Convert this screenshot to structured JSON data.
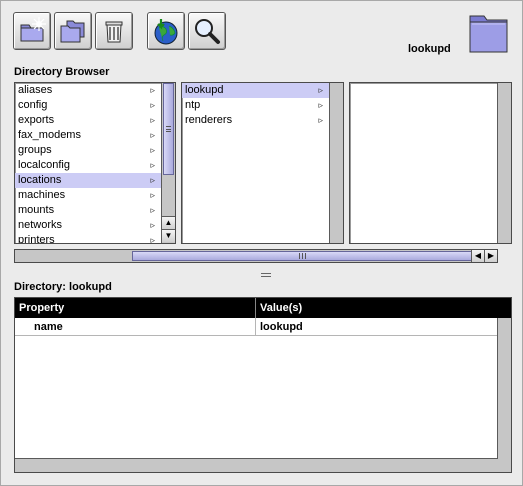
{
  "toolbar": {
    "buttons": [
      {
        "icon": "new-folder-sparkle-icon"
      },
      {
        "icon": "folders-icon"
      },
      {
        "icon": "trash-icon"
      },
      {
        "icon": "globe-refresh-icon"
      },
      {
        "icon": "magnifier-icon"
      }
    ]
  },
  "host": {
    "label": "lookupd",
    "icon": "blue-folder-icon"
  },
  "browser": {
    "title": "Directory Browser",
    "column1": [
      {
        "label": "aliases",
        "selected": false
      },
      {
        "label": "config",
        "selected": false
      },
      {
        "label": "exports",
        "selected": false
      },
      {
        "label": "fax_modems",
        "selected": false
      },
      {
        "label": "groups",
        "selected": false
      },
      {
        "label": "localconfig",
        "selected": false
      },
      {
        "label": "locations",
        "selected": true
      },
      {
        "label": "machines",
        "selected": false
      },
      {
        "label": "mounts",
        "selected": false
      },
      {
        "label": "networks",
        "selected": false
      },
      {
        "label": "printers",
        "selected": false
      }
    ],
    "column2": [
      {
        "label": "lookupd",
        "selected": true
      },
      {
        "label": "ntp",
        "selected": false
      },
      {
        "label": "renderers",
        "selected": false
      }
    ],
    "column3": [],
    "arrow_glyph": "▹"
  },
  "directory": {
    "title": "Directory: lookupd",
    "columns": [
      "Property",
      "Value(s)"
    ],
    "rows": [
      {
        "property": "name",
        "value": "lookupd"
      }
    ]
  },
  "colors": {
    "selection": "#ccccf5",
    "scroll_thumb": "#aaaadd",
    "header": "#000000"
  }
}
